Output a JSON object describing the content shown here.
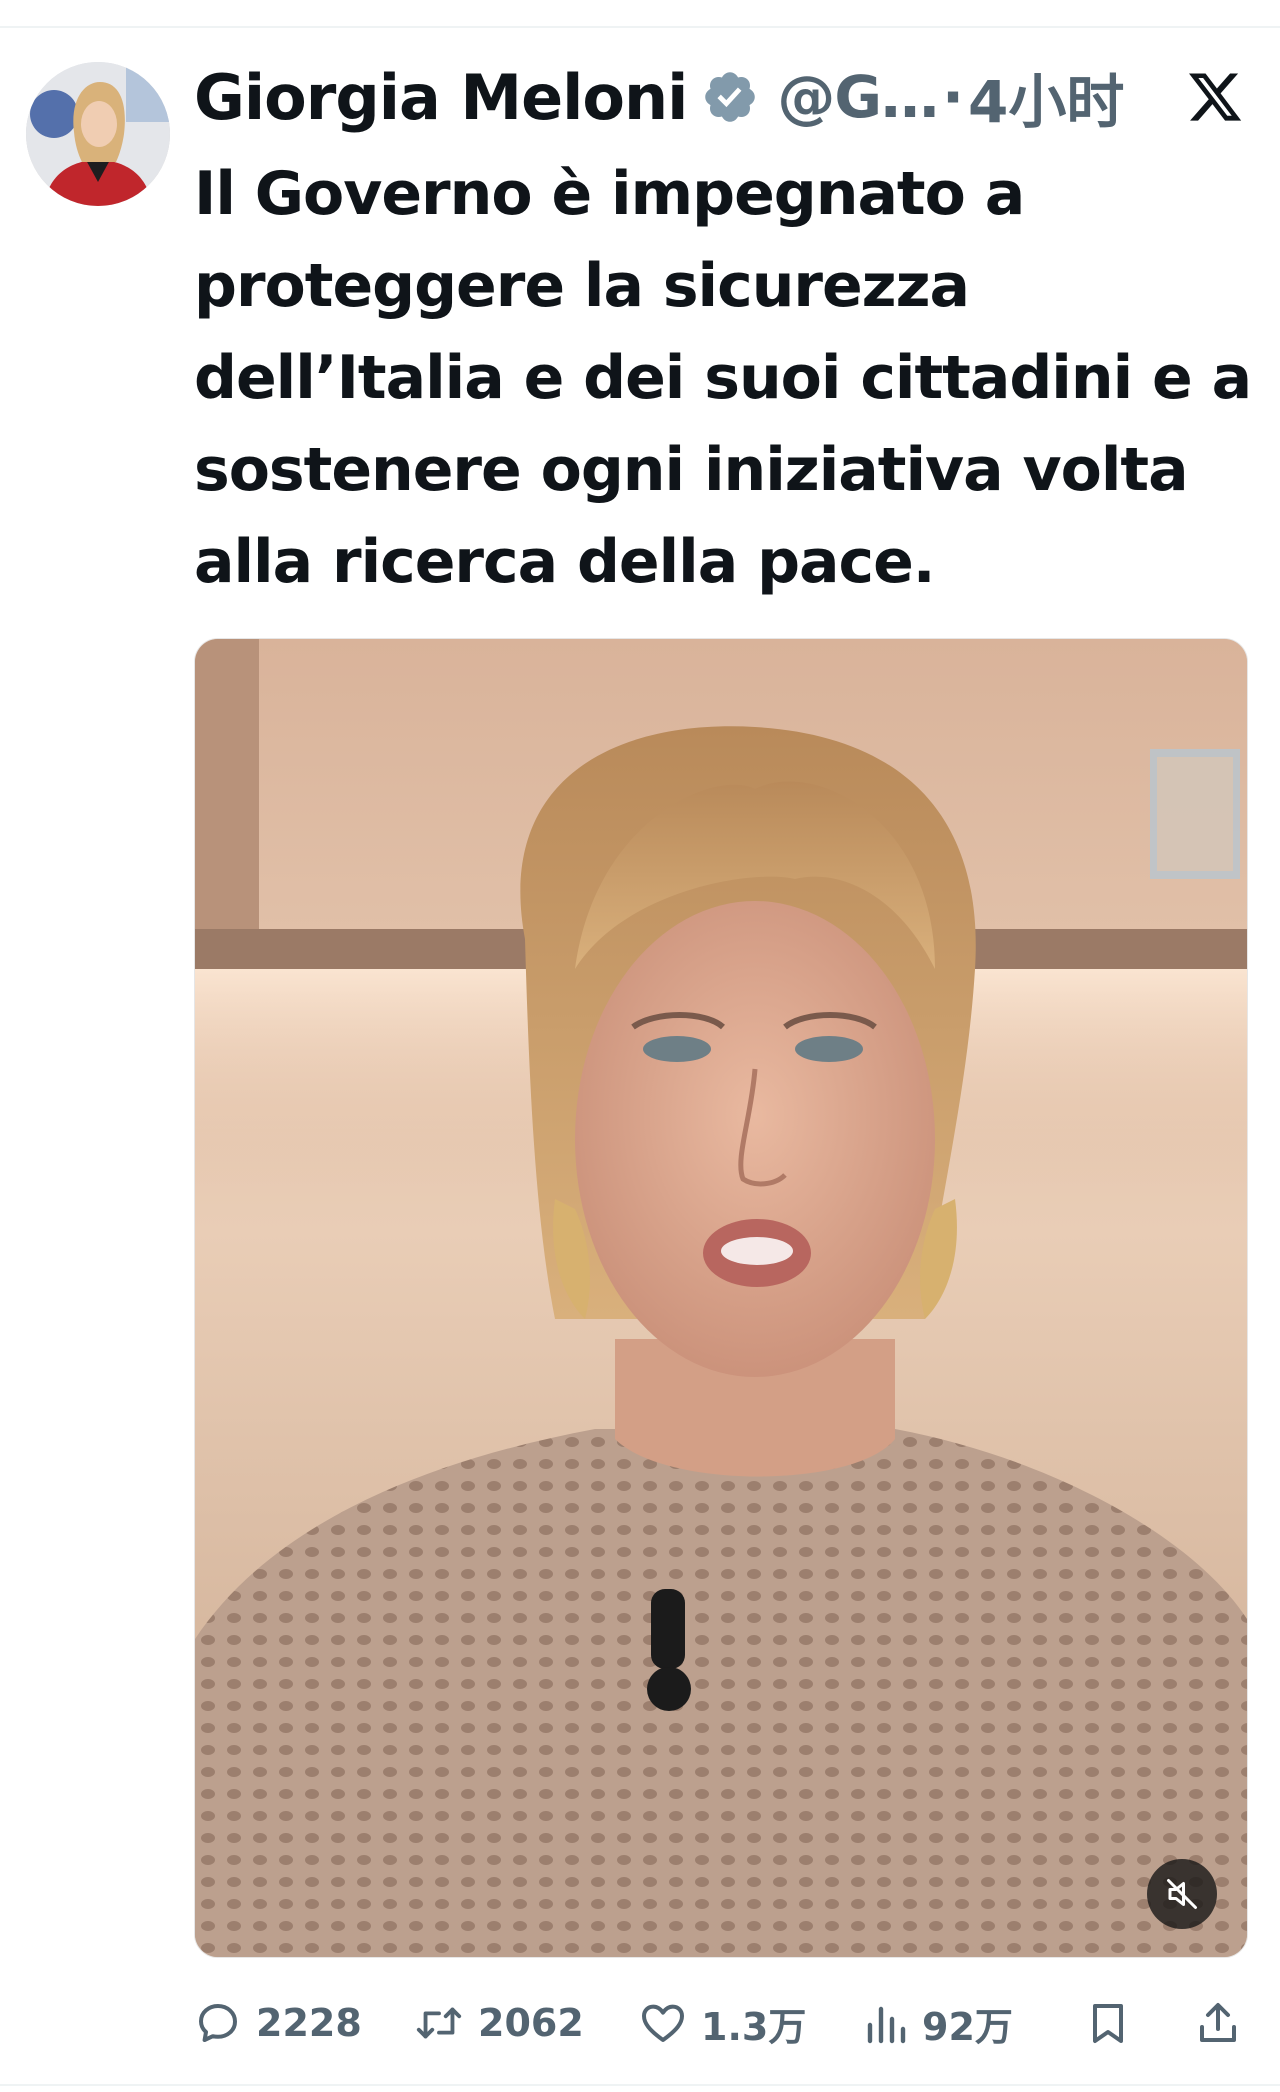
{
  "tweet": {
    "display_name": "Giorgia Meloni",
    "handle": "@G…",
    "separator": "·",
    "time": "4小时",
    "text": "Il Governo è impegnato a proteggere la sicurezza dell’Italia e dei suoi cittadini e a sostenere ogni iniziativa volta alla ricerca della pace."
  },
  "stats": {
    "replies": "2228",
    "reposts": "2062",
    "likes": "1.3万",
    "views": "92万"
  },
  "icons": {
    "verified": "verified-badge-icon",
    "platform": "x-logo-icon",
    "media_control": "muted-speaker-icon",
    "reply": "speech-bubble-icon",
    "repost": "repost-arrows-icon",
    "like": "heart-icon",
    "views": "bar-chart-icon",
    "bookmark": "bookmark-icon",
    "share": "share-upload-icon"
  },
  "colors": {
    "text_primary": "#0f1419",
    "text_secondary": "#536471",
    "verified_badge": "#829aab"
  }
}
